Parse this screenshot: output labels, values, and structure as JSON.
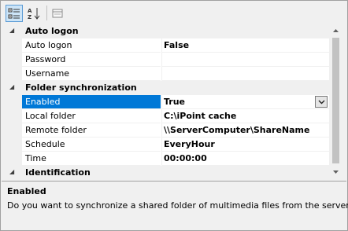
{
  "toolbar": {
    "categorized_icon": "categorized-icon",
    "alphabetical_icon": "alphabetical-sort-icon",
    "property_pages_icon": "property-pages-icon"
  },
  "grid": {
    "categories": [
      {
        "label": "Auto logon",
        "properties": [
          {
            "name": "Auto logon",
            "value": "False"
          },
          {
            "name": "Password",
            "value": ""
          },
          {
            "name": "Username",
            "value": ""
          }
        ]
      },
      {
        "label": "Folder synchronization",
        "properties": [
          {
            "name": "Enabled",
            "value": "True"
          },
          {
            "name": "Local folder",
            "value": "C:\\iPoint cache"
          },
          {
            "name": "Remote folder",
            "value": "\\\\ServerComputer\\ShareName"
          },
          {
            "name": "Schedule",
            "value": "EveryHour"
          },
          {
            "name": "Time",
            "value": "00:00:00"
          }
        ]
      },
      {
        "label": "Identification",
        "properties": []
      }
    ]
  },
  "description": {
    "title": "Enabled",
    "text": "Do you want to synchronize a shared folder of multimedia files from the server?"
  },
  "colors": {
    "selection": "#0078d7",
    "background": "#f0f0f0"
  }
}
